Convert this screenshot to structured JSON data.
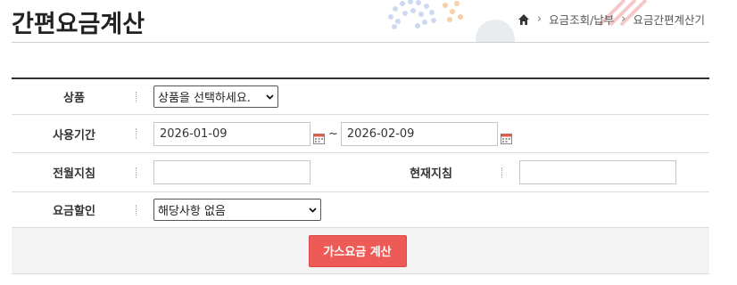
{
  "page": {
    "title": "간편요금계산"
  },
  "breadcrumb": {
    "items": [
      "요금조회/납부",
      "요금간편계산기"
    ]
  },
  "form": {
    "product": {
      "label": "상품",
      "selected": "상품을 선택하세요."
    },
    "period": {
      "label": "사용기간",
      "start": "2026-01-09",
      "separator": "~",
      "end": "2026-02-09"
    },
    "readings": {
      "prev_label": "전월지침",
      "prev_value": "",
      "curr_label": "현재지침",
      "curr_value": ""
    },
    "discount": {
      "label": "요금할인",
      "selected": "해당사항 없음"
    }
  },
  "actions": {
    "calculate_label": "가스요금 계산"
  },
  "colors": {
    "accent": "#ee5a55",
    "decor_blue": "#c8d4ee",
    "decor_orange": "#f6c9a0",
    "decor_pink": "#f4c6c6"
  }
}
